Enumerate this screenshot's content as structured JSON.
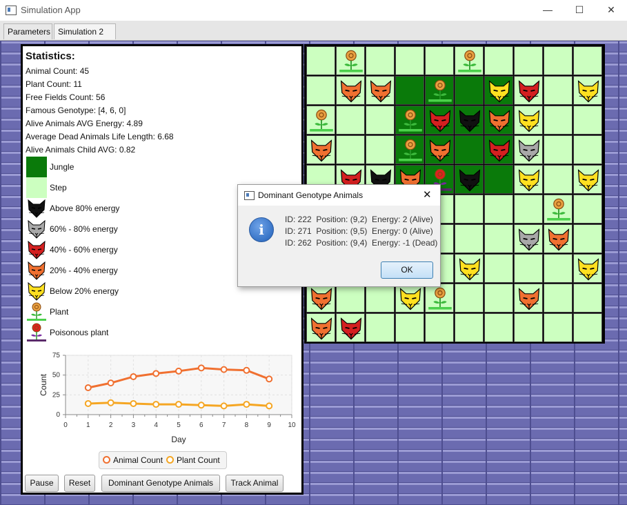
{
  "window": {
    "title": "Simulation App",
    "minimize_label": "—",
    "maximize_label": "☐",
    "close_label": "✕"
  },
  "tabs": [
    {
      "label": "Parameters"
    },
    {
      "label": "Simulation 2"
    }
  ],
  "tab_close_label": "✕",
  "stats": {
    "heading": "Statistics:",
    "lines": [
      "Animal Count: 45",
      "Plant Count: 11",
      "Free Fields Count: 56",
      "Famous Genotype: [4, 6, 0]",
      "Alive Animals AVG Energy: 4.89",
      "Average Dead Animals Life Length: 6.68",
      "Alive Animals Child AVG: 0.82"
    ]
  },
  "legend": [
    {
      "label": "Jungle",
      "kind": "jungle-swatch",
      "color": "#0a7a0a"
    },
    {
      "label": "Step",
      "kind": "step-swatch",
      "color": "#ccffc0"
    },
    {
      "label": "Above 80% energy",
      "kind": "cat-icon",
      "color": "#111111"
    },
    {
      "label": "60% - 80% energy",
      "kind": "cat-icon",
      "color": "#a8a8a8"
    },
    {
      "label": "40% - 60% energy",
      "kind": "cat-icon",
      "color": "#d42020"
    },
    {
      "label": "20% - 40% energy",
      "kind": "cat-icon",
      "color": "#f07030"
    },
    {
      "label": "Below 20% energy",
      "kind": "cat-icon",
      "color": "#ffe020"
    },
    {
      "label": "Plant",
      "kind": "plant-icon",
      "color": "#e8a040"
    },
    {
      "label": "Poisonous plant",
      "kind": "poison-plant-icon",
      "color": "#e02020"
    }
  ],
  "chart_data": {
    "type": "line",
    "x": [
      1,
      2,
      3,
      4,
      5,
      6,
      7,
      8,
      9
    ],
    "series": [
      {
        "name": "Animal Count",
        "color": "#f07030",
        "values": [
          34,
          40,
          48,
          52,
          55,
          59,
          57,
          56,
          45
        ]
      },
      {
        "name": "Plant Count",
        "color": "#f5a623",
        "values": [
          14,
          15,
          14,
          13,
          13,
          12,
          11,
          13,
          11
        ]
      }
    ],
    "xlabel": "Day",
    "ylabel": "Count",
    "xlim": [
      0,
      10
    ],
    "ylim": [
      0,
      75
    ],
    "xticks": [
      "0",
      "1",
      "2",
      "3",
      "4",
      "5",
      "6",
      "7",
      "8",
      "9",
      "10"
    ],
    "yticks": [
      "0",
      "25",
      "50",
      "75"
    ],
    "grid": true,
    "legend_position": "bottom"
  },
  "buttons": {
    "pause": "Pause",
    "reset": "Reset",
    "dominant": "Dominant Genotype Animals",
    "track": "Track Animal"
  },
  "map": {
    "rows": 10,
    "cols": 10,
    "jungle": [
      [
        1,
        3
      ],
      [
        1,
        4
      ],
      [
        1,
        5
      ],
      [
        1,
        6
      ],
      [
        2,
        3
      ],
      [
        2,
        4
      ],
      [
        2,
        5
      ],
      [
        2,
        6
      ],
      [
        3,
        3
      ],
      [
        3,
        4
      ],
      [
        3,
        5
      ],
      [
        3,
        6
      ],
      [
        4,
        3
      ],
      [
        4,
        4
      ],
      [
        4,
        5
      ],
      [
        4,
        6
      ]
    ],
    "entities": [
      [
        0,
        1,
        "plant"
      ],
      [
        0,
        5,
        "plant"
      ],
      [
        1,
        1,
        "orange"
      ],
      [
        1,
        2,
        "orange"
      ],
      [
        1,
        4,
        "plant"
      ],
      [
        1,
        6,
        "yellow"
      ],
      [
        1,
        7,
        "red"
      ],
      [
        1,
        9,
        "yellow"
      ],
      [
        2,
        0,
        "plant"
      ],
      [
        2,
        3,
        "plant"
      ],
      [
        2,
        4,
        "red"
      ],
      [
        2,
        5,
        "black"
      ],
      [
        2,
        6,
        "orange"
      ],
      [
        2,
        7,
        "yellow"
      ],
      [
        3,
        0,
        "orange"
      ],
      [
        3,
        3,
        "plant"
      ],
      [
        3,
        4,
        "orange"
      ],
      [
        3,
        6,
        "red"
      ],
      [
        3,
        7,
        "gray"
      ],
      [
        4,
        1,
        "red"
      ],
      [
        4,
        2,
        "black"
      ],
      [
        4,
        3,
        "orange"
      ],
      [
        4,
        4,
        "poison"
      ],
      [
        4,
        5,
        "black"
      ],
      [
        4,
        7,
        "yellow"
      ],
      [
        4,
        9,
        "yellow"
      ],
      [
        5,
        8,
        "plant"
      ],
      [
        6,
        7,
        "gray"
      ],
      [
        6,
        8,
        "orange"
      ],
      [
        7,
        5,
        "yellow"
      ],
      [
        7,
        9,
        "yellow"
      ],
      [
        8,
        0,
        "orange"
      ],
      [
        8,
        3,
        "yellow"
      ],
      [
        8,
        4,
        "plant"
      ],
      [
        8,
        7,
        "orange"
      ],
      [
        9,
        0,
        "orange"
      ],
      [
        9,
        1,
        "red"
      ]
    ],
    "energy_colors": {
      "black": "#111111",
      "gray": "#a8a8a8",
      "red": "#d42020",
      "orange": "#f07030",
      "yellow": "#ffe020"
    }
  },
  "dialog": {
    "title": "Dominant Genotype Animals",
    "close_label": "✕",
    "info_glyph": "i",
    "lines": [
      "ID: 222  Position: (9,2)  Energy: 2 (Alive)",
      "ID: 271  Position: (9,5)  Energy: 0 (Alive)",
      "ID: 262  Position: (9,4)  Energy: -1 (Dead)"
    ],
    "ok_label": "OK"
  }
}
